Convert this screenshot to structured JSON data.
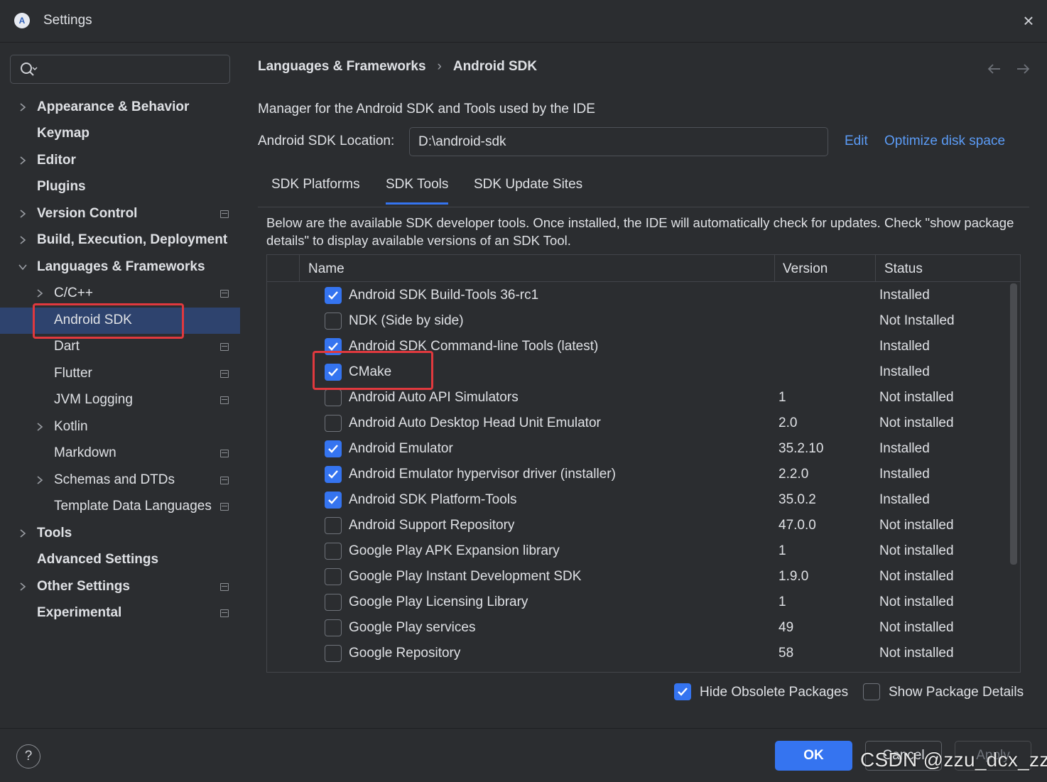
{
  "window": {
    "title": "Settings"
  },
  "search": {
    "placeholder": ""
  },
  "sidebar": {
    "items": [
      {
        "label": "Appearance & Behavior"
      },
      {
        "label": "Keymap"
      },
      {
        "label": "Editor"
      },
      {
        "label": "Plugins"
      },
      {
        "label": "Version Control"
      },
      {
        "label": "Build, Execution, Deployment"
      },
      {
        "label": "Languages & Frameworks"
      },
      {
        "label": "C/C++"
      },
      {
        "label": "Android SDK"
      },
      {
        "label": "Dart"
      },
      {
        "label": "Flutter"
      },
      {
        "label": "JVM Logging"
      },
      {
        "label": "Kotlin"
      },
      {
        "label": "Markdown"
      },
      {
        "label": "Schemas and DTDs"
      },
      {
        "label": "Template Data Languages"
      },
      {
        "label": "Tools"
      },
      {
        "label": "Advanced Settings"
      },
      {
        "label": "Other Settings"
      },
      {
        "label": "Experimental"
      }
    ]
  },
  "breadcrumb": {
    "parent": "Languages & Frameworks",
    "separator": "›",
    "current": "Android SDK"
  },
  "main": {
    "description": "Manager for the Android SDK and Tools used by the IDE",
    "location_label": "Android SDK Location:",
    "location_value": "D:\\android-sdk",
    "edit_link": "Edit",
    "optimize_link": "Optimize disk space"
  },
  "tabs": [
    {
      "label": "SDK Platforms"
    },
    {
      "label": "SDK Tools"
    },
    {
      "label": "SDK Update Sites"
    }
  ],
  "info_text": "Below are the available SDK developer tools. Once installed, the IDE will automatically check for updates. Check \"show package details\" to display available versions of an SDK Tool.",
  "table": {
    "headers": {
      "name": "Name",
      "version": "Version",
      "status": "Status"
    },
    "rows": [
      {
        "name": "Android SDK Build-Tools 36-rc1",
        "version": "",
        "status": "Installed",
        "checked": true
      },
      {
        "name": "NDK (Side by side)",
        "version": "",
        "status": "Not Installed",
        "checked": false
      },
      {
        "name": "Android SDK Command-line Tools (latest)",
        "version": "",
        "status": "Installed",
        "checked": true
      },
      {
        "name": "CMake",
        "version": "",
        "status": "Installed",
        "checked": true
      },
      {
        "name": "Android Auto API Simulators",
        "version": "1",
        "status": "Not installed",
        "checked": false
      },
      {
        "name": "Android Auto Desktop Head Unit Emulator",
        "version": "2.0",
        "status": "Not installed",
        "checked": false
      },
      {
        "name": "Android Emulator",
        "version": "35.2.10",
        "status": "Installed",
        "checked": true
      },
      {
        "name": "Android Emulator hypervisor driver (installer)",
        "version": "2.2.0",
        "status": "Installed",
        "checked": true
      },
      {
        "name": "Android SDK Platform-Tools",
        "version": "35.0.2",
        "status": "Installed",
        "checked": true
      },
      {
        "name": "Android Support Repository",
        "version": "47.0.0",
        "status": "Not installed",
        "checked": false
      },
      {
        "name": "Google Play APK Expansion library",
        "version": "1",
        "status": "Not installed",
        "checked": false
      },
      {
        "name": "Google Play Instant Development SDK",
        "version": "1.9.0",
        "status": "Not installed",
        "checked": false
      },
      {
        "name": "Google Play Licensing Library",
        "version": "1",
        "status": "Not installed",
        "checked": false
      },
      {
        "name": "Google Play services",
        "version": "49",
        "status": "Not installed",
        "checked": false
      },
      {
        "name": "Google Repository",
        "version": "58",
        "status": "Not installed",
        "checked": false
      }
    ]
  },
  "options": {
    "hide_obsolete": {
      "label": "Hide Obsolete Packages",
      "checked": true
    },
    "show_details": {
      "label": "Show Package Details",
      "checked": false
    }
  },
  "footer": {
    "help": "?",
    "ok": "OK",
    "cancel": "Cancel",
    "apply": "Apply"
  },
  "watermark": "CSDN @zzu_dcx_zzu",
  "colors": {
    "accent": "#3574f0",
    "link": "#5b9bf5",
    "highlight": "#e0393e",
    "selection": "#2e436e",
    "background": "#2b2d30"
  }
}
